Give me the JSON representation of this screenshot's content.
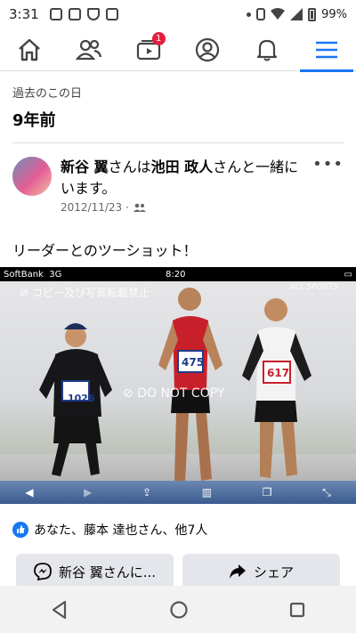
{
  "status_bar": {
    "time": "3:31",
    "battery": "99%"
  },
  "nav": {
    "notifications_badge": "1"
  },
  "memories": {
    "label": "過去のこの日",
    "title": "9年前"
  },
  "post": {
    "author": "新谷 翼",
    "with_text": "さんは",
    "friend": "池田 政人",
    "suffix": "さんと一緒にいます。",
    "date": "2012/11/23 ·",
    "text": "リーダーとのツーショット！"
  },
  "photo": {
    "carrier": "SoftBank",
    "network": "3G",
    "time": "8:20",
    "watermark": "コピー及び写真転載禁止",
    "do_not_copy": "DO NOT COPY",
    "bib_left": "1026",
    "bib_center": "475",
    "bib_right": "617"
  },
  "reactions": {
    "text": "あなた、藤本 達也さん、他7人"
  },
  "actions": {
    "message_label": "新谷 翼さんに...",
    "share_label": "シェア"
  }
}
